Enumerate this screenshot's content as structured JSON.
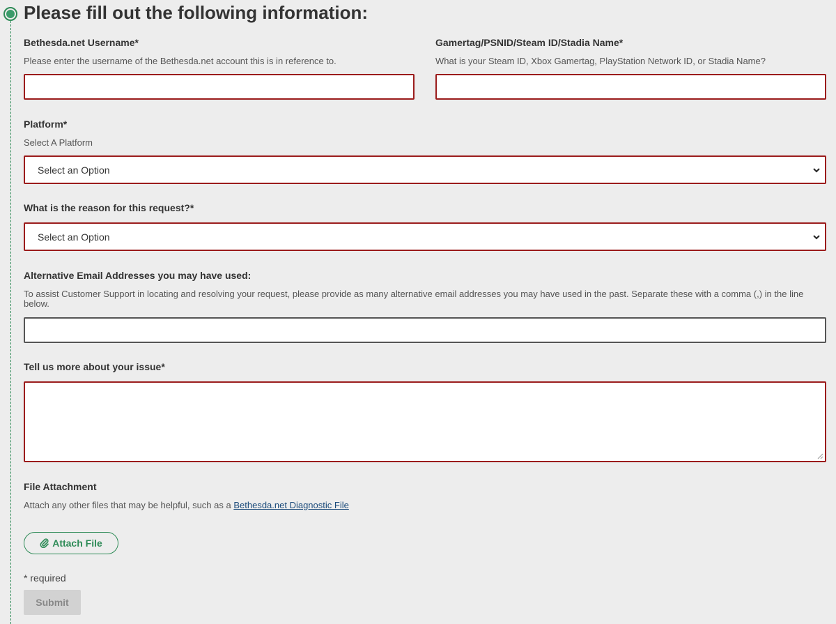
{
  "form": {
    "title": "Please fill out the following information:",
    "username": {
      "label": "Bethesda.net Username*",
      "help": "Please enter the username of the Bethesda.net account this is in reference to.",
      "value": ""
    },
    "gamertag": {
      "label": "Gamertag/PSNID/Steam ID/Stadia Name*",
      "help": "What is your Steam ID, Xbox Gamertag, PlayStation Network ID, or Stadia Name?",
      "value": ""
    },
    "platform": {
      "label": "Platform*",
      "help": "Select A Platform",
      "selected": "Select an Option"
    },
    "reason": {
      "label": "What is the reason for this request?*",
      "selected": "Select an Option"
    },
    "alt_emails": {
      "label": "Alternative Email Addresses you may have used:",
      "help": "To assist Customer Support in locating and resolving your request, please provide as many alternative email addresses you may have used in the past. Separate these with a comma (,) in the line below.",
      "value": ""
    },
    "issue": {
      "label": "Tell us more about your issue*",
      "value": ""
    },
    "attachment": {
      "label": "File Attachment",
      "help_prefix": "Attach any other files that may be helpful, such as a ",
      "help_link": "Bethesda.net Diagnostic File",
      "button_label": "Attach File",
      "button_icon": "paperclip-icon"
    },
    "required_note": "* required",
    "submit_label": "Submit"
  },
  "colors": {
    "accent": "#2e8b57",
    "error_border": "#9b1c1c",
    "link": "#1a4a7a",
    "disabled_bg": "#d2d2d2"
  }
}
